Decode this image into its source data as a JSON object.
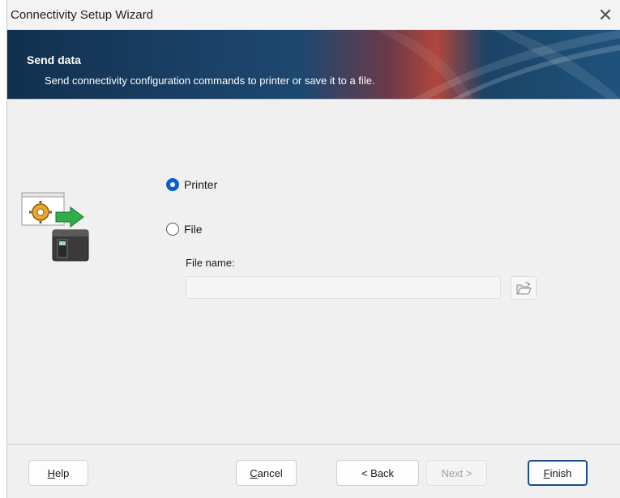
{
  "window": {
    "title": "Connectivity Setup Wizard",
    "close_glyph": "✕"
  },
  "header": {
    "title": "Send data",
    "subtitle": "Send connectivity configuration commands to printer or save it to a file."
  },
  "options": {
    "printer": {
      "label": "Printer",
      "selected": true
    },
    "file": {
      "label": "File",
      "selected": false
    }
  },
  "file_name": {
    "label": "File name:",
    "value": "",
    "placeholder": ""
  },
  "icons": {
    "wizard": "gear-printer-arrow-icon",
    "browse": "folder-open-icon",
    "close": "close-icon"
  },
  "buttons": {
    "help": "Help",
    "cancel": "Cancel",
    "back": "< Back",
    "next": "Next >",
    "finish": "Finish"
  },
  "colors": {
    "accent": "#0b5fc7",
    "banner_dark": "#12304d",
    "banner_highlight": "#b0463c"
  }
}
